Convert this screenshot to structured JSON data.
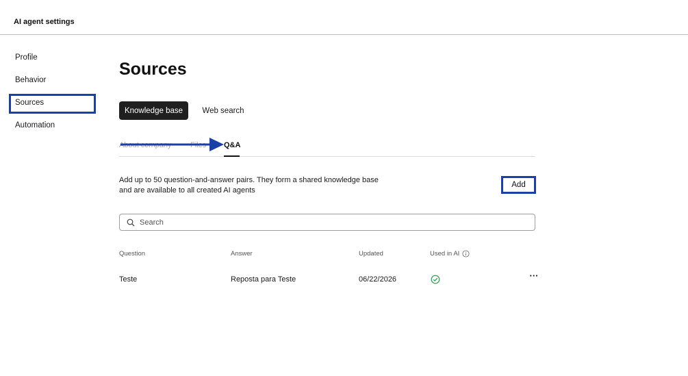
{
  "header": {
    "title": "AI agent settings"
  },
  "sidebar": {
    "items": [
      {
        "label": "Profile"
      },
      {
        "label": "Behavior"
      },
      {
        "label": "Sources"
      },
      {
        "label": "Automation"
      }
    ]
  },
  "main": {
    "title": "Sources",
    "tabs": [
      {
        "label": "Knowledge base",
        "active": true
      },
      {
        "label": "Web search",
        "active": false
      }
    ],
    "subtabs": [
      {
        "label": "About company"
      },
      {
        "label": "Files"
      },
      {
        "label": "Q&A",
        "active": true
      }
    ],
    "description_line1": "Add up to 50 question-and-answer pairs. They form a shared knowledge base",
    "description_line2": "and are available to all created AI agents",
    "add_label": "Add",
    "search": {
      "placeholder": "Search",
      "value": ""
    },
    "table": {
      "columns": [
        "Question",
        "Answer",
        "Updated",
        "Used in AI"
      ],
      "rows": [
        {
          "question": "Teste",
          "answer": "Reposta para Teste",
          "updated": "06/22/2026",
          "used_in_ai": true
        }
      ]
    }
  },
  "colors": {
    "highlight": "#1a3fa8",
    "active_tab_bg": "#1f1f1f",
    "success": "#2e9e4f"
  },
  "icons": [
    "search-icon",
    "info-icon",
    "check-circle-icon",
    "more-icon",
    "arrow-icon"
  ]
}
